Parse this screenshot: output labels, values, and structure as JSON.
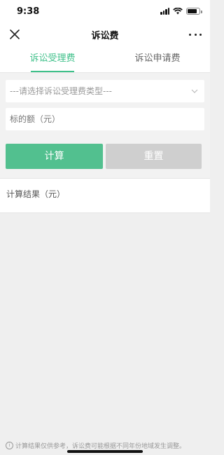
{
  "status_bar": {
    "time": "9:38"
  },
  "nav": {
    "title": "诉讼费"
  },
  "tabs": [
    {
      "label": "诉讼受理费",
      "active": true
    },
    {
      "label": "诉讼申请费",
      "active": false
    }
  ],
  "form": {
    "type_select_placeholder": "---请选择诉讼受理费类型---",
    "amount_placeholder": "标的额（元）",
    "calc_button": "计算",
    "reset_button": "重置"
  },
  "result": {
    "label": "计算结果（元）"
  },
  "footer": {
    "notice": "计算结果仅供参考，诉讼费可能根据不同年份地域发生调整。"
  },
  "colors": {
    "accent": "#3fc08a",
    "button_primary": "#52c08f",
    "button_disabled": "#cfcfcf",
    "background": "#efefef"
  },
  "icons": [
    "close-icon",
    "more-icon",
    "chevron-down-icon",
    "info-icon",
    "signal-icon",
    "wifi-icon",
    "battery-icon"
  ]
}
